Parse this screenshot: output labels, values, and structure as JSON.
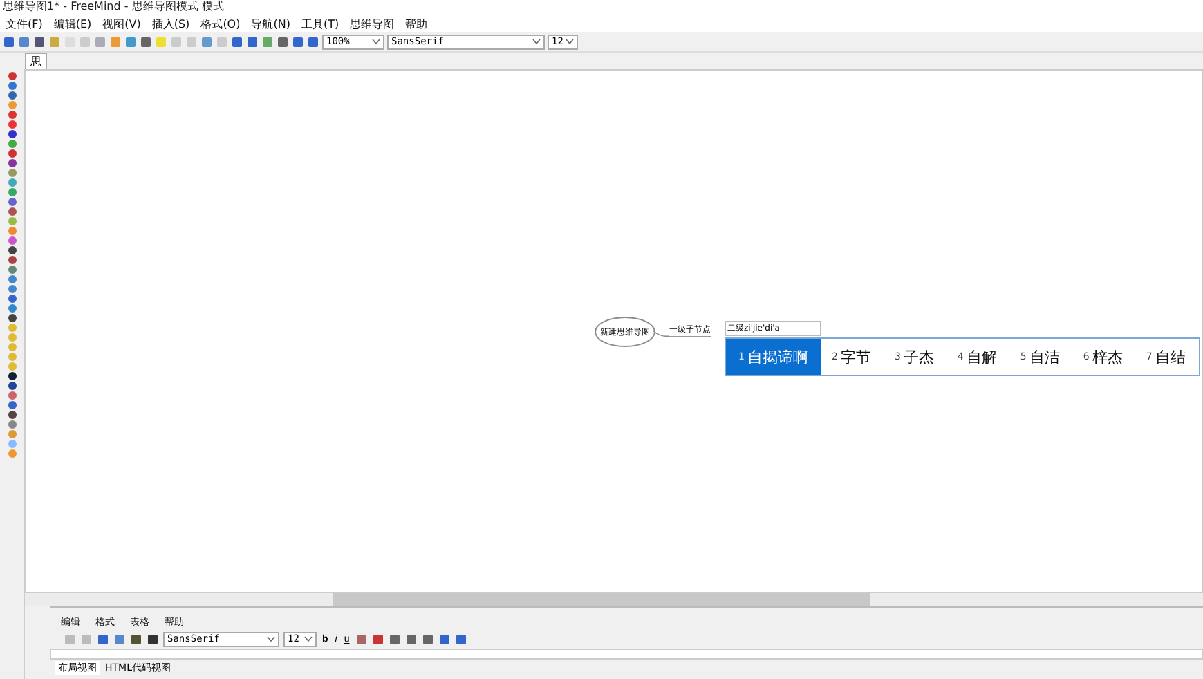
{
  "window": {
    "title": "思维导图1* - FreeMind - 思维导图模式 模式"
  },
  "menu": [
    "文件(F)",
    "编辑(E)",
    "视图(V)",
    "插入(S)",
    "格式(O)",
    "导航(N)",
    "工具(T)",
    "思维导图",
    "帮助"
  ],
  "toolbar": {
    "zoom": "100%",
    "font": "SansSerif",
    "size": "12"
  },
  "tab": {
    "label": "思"
  },
  "map": {
    "root": "新建思维导图",
    "child": "一级子节点",
    "editing": "二级zi'jie'di'a"
  },
  "ime": {
    "candidates": [
      {
        "index": "1",
        "text": "自揭谛啊",
        "selected": true
      },
      {
        "index": "2",
        "text": "字节",
        "selected": false
      },
      {
        "index": "3",
        "text": "子杰",
        "selected": false
      },
      {
        "index": "4",
        "text": "自解",
        "selected": false
      },
      {
        "index": "5",
        "text": "自洁",
        "selected": false
      },
      {
        "index": "6",
        "text": "梓杰",
        "selected": false
      },
      {
        "index": "7",
        "text": "自结",
        "selected": false
      }
    ]
  },
  "note_editor": {
    "menu": [
      "编辑",
      "格式",
      "表格",
      "帮助"
    ],
    "font": "SansSerif",
    "size": "12",
    "format_buttons": [
      "b",
      "i",
      "u"
    ],
    "tabs": [
      {
        "label": "布局视图",
        "selected": true
      },
      {
        "label": "HTML代码视图",
        "selected": false
      }
    ]
  }
}
